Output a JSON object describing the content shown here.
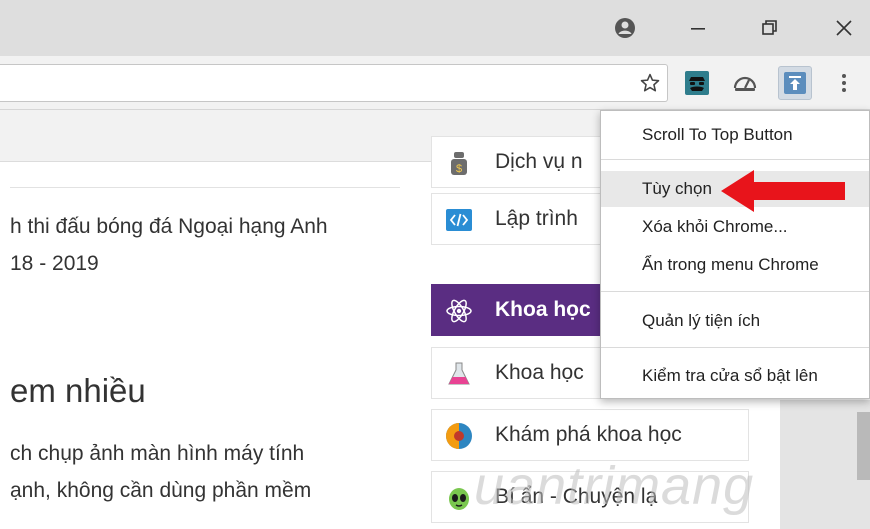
{
  "menu": {
    "items": [
      "Scroll To Top Button",
      "Tùy chọn",
      "Xóa khỏi Chrome...",
      "Ẩn trong menu Chrome",
      "Quản lý tiện ích",
      "Kiểm tra cửa sổ bật lên"
    ]
  },
  "page": {
    "lines": [
      "h thi đấu bóng đá Ngoại hạng Anh",
      "18 - 2019",
      "ch chụp ảnh màn hình máy tính",
      "ạnh, không cần dùng phần mềm"
    ],
    "heading": "em nhiều"
  },
  "categories": [
    {
      "label": "Dịch vụ n",
      "icon": "money-bag-icon"
    },
    {
      "label": "Lập trình",
      "icon": "code-icon"
    },
    {
      "label": "Khoa học",
      "icon": "atom-icon"
    },
    {
      "label": "Khoa học",
      "icon": "flask-icon"
    },
    {
      "label": "Khám phá khoa học",
      "icon": "globe-icon"
    },
    {
      "label": "Bí ẩn - Chuyện lạ",
      "icon": "alien-icon"
    }
  ],
  "watermark": "uantrimang",
  "colors": {
    "category_active": "#5a2d82",
    "arrow": "#e8141b",
    "extension_active": "#5b8dbd"
  },
  "icons": {
    "profile": "profile-icon",
    "minimize": "minimize-icon",
    "restore": "restore-icon",
    "close": "close-icon",
    "star": "star-icon",
    "extension_1": "disguise-icon",
    "extension_2": "dashboard-icon",
    "extension_3": "scroll-to-top-icon",
    "more": "more-vert-icon"
  }
}
